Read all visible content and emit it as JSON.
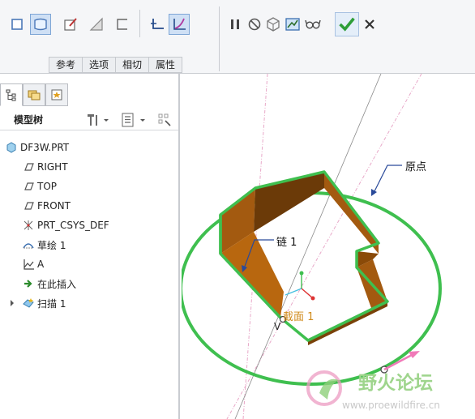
{
  "ribbon": {
    "tabs": [
      "参考",
      "选项",
      "相切",
      "属性"
    ],
    "tools": {
      "solid": "solid-icon",
      "surface": "surface-icon",
      "sketch": "sketch-icon",
      "remove_material": "remove-material-icon",
      "thicken": "thicken-icon",
      "constant_section": "constant-section-icon",
      "variable_section": "variable-section-icon",
      "pause": "pause-icon",
      "no_preview": "no-preview-icon",
      "verify_mode": "verify-mode-icon",
      "preview": "preview-icon",
      "glasses": "glasses-icon",
      "ok": "checkmark-icon",
      "cancel": "close-icon"
    }
  },
  "panel": {
    "title": "模型树",
    "items": [
      {
        "label": "DF3W.PRT",
        "icon": "part-icon"
      },
      {
        "label": "RIGHT",
        "icon": "datum-plane-icon"
      },
      {
        "label": "TOP",
        "icon": "datum-plane-icon"
      },
      {
        "label": "FRONT",
        "icon": "datum-plane-icon"
      },
      {
        "label": "PRT_CSYS_DEF",
        "icon": "coordinate-system-icon"
      },
      {
        "label": "草绘 1",
        "icon": "sketch-feature-icon"
      },
      {
        "label": "A",
        "icon": "datum-curve-icon"
      },
      {
        "label": "在此插入",
        "icon": "insert-here-arrow-icon"
      },
      {
        "label": "扫描 1",
        "icon": "sweep-icon"
      }
    ]
  },
  "viewport": {
    "labels": {
      "origin": "原点",
      "chain": "链 1",
      "section": "截面 1",
      "trajectory_end": "V"
    }
  },
  "watermark": {
    "title": "野火论坛",
    "url": "www.proewildfire.cn"
  },
  "colors": {
    "accent_green": "#3fbf4f",
    "part_brown": "#8a4a08",
    "origin_pink": "#d05a8c",
    "section_label": "#d08a1a",
    "confirm_green": "#2e9e38"
  }
}
